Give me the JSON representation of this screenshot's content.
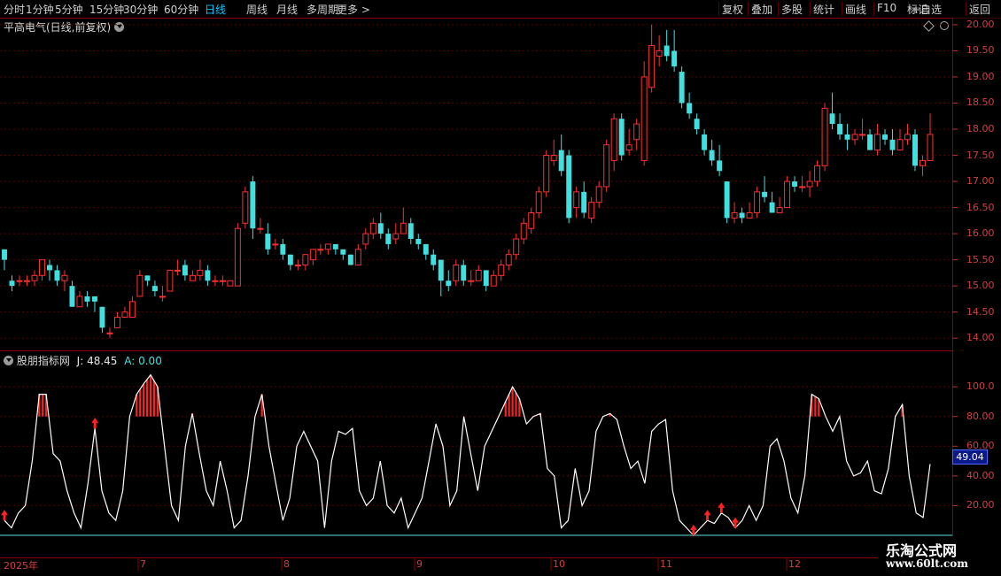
{
  "toolbar": {
    "left_items": [
      "分时",
      "1分钟",
      "5分钟",
      "15分钟",
      "30分钟",
      "60分钟",
      "日线",
      "周线",
      "月线",
      "多周期",
      "更多 >"
    ],
    "active": "日线",
    "right_items": [
      "复权",
      "叠加",
      "多股",
      "统计",
      "画线",
      "F10",
      "+自选",
      "返回"
    ],
    "marks_label": "标记"
  },
  "main_chart": {
    "title": "平高电气(日线,前复权)",
    "price_ticks": [
      "20.00",
      "19.50",
      "19.00",
      "18.50",
      "18.00",
      "17.50",
      "17.00",
      "16.50",
      "16.00",
      "15.50",
      "15.00",
      "14.50",
      "14.00"
    ]
  },
  "indicator": {
    "name": "股朋指标网",
    "j_label": "J: 48.45",
    "a_label": "A: 0.00",
    "ticks": [
      "100.0",
      "80.00",
      "60.00",
      "40.00",
      "20.00"
    ],
    "current_value": "49.04"
  },
  "x_axis": {
    "labels": [
      "2025年",
      "7",
      "8",
      "9",
      "10",
      "11",
      "12"
    ]
  },
  "watermark": {
    "line1": "乐淘公式网",
    "line2": "www.60lt.com"
  },
  "colors": {
    "up": "#ff3030",
    "down": "#40e0e0",
    "line": "#ffffff",
    "baseline": "#60e0e0",
    "grid": "#5a0000"
  },
  "chart_data": {
    "type": "candlestick",
    "ylim": [
      13.8,
      20.1
    ],
    "candles": [
      [
        15.7,
        15.5,
        15.7,
        15.3
      ],
      [
        15.1,
        15.0,
        15.2,
        14.9
      ],
      [
        15.1,
        15.1,
        15.2,
        15.0
      ],
      [
        15.1,
        15.1,
        15.2,
        15.0
      ],
      [
        15.1,
        15.2,
        15.3,
        15.0
      ],
      [
        15.2,
        15.5,
        15.5,
        15.1
      ],
      [
        15.4,
        15.3,
        15.5,
        15.1
      ],
      [
        15.3,
        15.1,
        15.4,
        15.0
      ],
      [
        15.1,
        15.2,
        15.3,
        14.9
      ],
      [
        15.0,
        14.6,
        15.1,
        14.6
      ],
      [
        14.6,
        14.8,
        14.9,
        14.6
      ],
      [
        14.8,
        14.7,
        14.9,
        14.6
      ],
      [
        14.8,
        14.7,
        14.8,
        14.5
      ],
      [
        14.6,
        14.2,
        14.6,
        14.1
      ],
      [
        14.1,
        14.1,
        14.2,
        14.0
      ],
      [
        14.2,
        14.4,
        14.5,
        14.2
      ],
      [
        14.4,
        14.5,
        14.6,
        14.4
      ],
      [
        14.4,
        14.7,
        14.8,
        14.4
      ],
      [
        14.8,
        15.2,
        15.3,
        14.8
      ],
      [
        15.2,
        15.1,
        15.2,
        15.0
      ],
      [
        15.0,
        14.9,
        15.1,
        14.8
      ],
      [
        14.8,
        14.8,
        15.0,
        14.7
      ],
      [
        14.9,
        15.3,
        15.3,
        14.9
      ],
      [
        15.3,
        15.3,
        15.5,
        15.2
      ],
      [
        15.4,
        15.2,
        15.5,
        15.1
      ],
      [
        15.1,
        15.2,
        15.3,
        15.1
      ],
      [
        15.2,
        15.3,
        15.5,
        15.1
      ],
      [
        15.3,
        15.1,
        15.4,
        15.0
      ],
      [
        15.1,
        15.1,
        15.2,
        15.0
      ],
      [
        15.1,
        15.1,
        15.2,
        15.0
      ],
      [
        15.0,
        15.1,
        15.1,
        15.0
      ],
      [
        15.0,
        16.1,
        16.2,
        15.9
      ],
      [
        16.2,
        16.8,
        16.9,
        16.1
      ],
      [
        17.0,
        16.1,
        17.1,
        15.9
      ],
      [
        16.1,
        16.1,
        16.3,
        16.0
      ],
      [
        16.0,
        15.7,
        16.2,
        15.6
      ],
      [
        15.8,
        15.8,
        15.9,
        15.7
      ],
      [
        15.8,
        15.6,
        15.9,
        15.5
      ],
      [
        15.6,
        15.4,
        15.6,
        15.3
      ],
      [
        15.4,
        15.4,
        15.5,
        15.3
      ],
      [
        15.4,
        15.6,
        15.6,
        15.3
      ],
      [
        15.5,
        15.7,
        15.7,
        15.4
      ],
      [
        15.7,
        15.7,
        15.8,
        15.6
      ],
      [
        15.7,
        15.8,
        15.8,
        15.6
      ],
      [
        15.8,
        15.7,
        15.8,
        15.6
      ],
      [
        15.7,
        15.6,
        15.7,
        15.5
      ],
      [
        15.6,
        15.4,
        15.6,
        15.4
      ],
      [
        15.4,
        15.7,
        15.8,
        15.4
      ],
      [
        15.8,
        16.0,
        16.1,
        15.7
      ],
      [
        16.0,
        16.2,
        16.3,
        15.9
      ],
      [
        16.2,
        16.0,
        16.4,
        15.9
      ],
      [
        16.0,
        15.8,
        16.1,
        15.7
      ],
      [
        15.9,
        16.0,
        16.2,
        15.8
      ],
      [
        16.0,
        16.2,
        16.5,
        16.0
      ],
      [
        16.2,
        15.9,
        16.3,
        15.8
      ],
      [
        15.9,
        15.8,
        16.0,
        15.7
      ],
      [
        15.8,
        15.6,
        15.8,
        15.5
      ],
      [
        15.6,
        15.4,
        15.7,
        15.3
      ],
      [
        15.5,
        15.1,
        15.5,
        14.8
      ],
      [
        15.1,
        15.0,
        15.3,
        14.9
      ],
      [
        15.1,
        15.4,
        15.5,
        15.0
      ],
      [
        15.4,
        15.1,
        15.5,
        15.0
      ],
      [
        15.1,
        15.1,
        15.3,
        15.0
      ],
      [
        15.1,
        15.3,
        15.4,
        15.1
      ],
      [
        15.3,
        15.0,
        15.3,
        14.9
      ],
      [
        15.0,
        15.2,
        15.3,
        15.0
      ],
      [
        15.2,
        15.4,
        15.5,
        15.1
      ],
      [
        15.4,
        15.6,
        15.7,
        15.3
      ],
      [
        15.6,
        15.9,
        16.0,
        15.5
      ],
      [
        15.9,
        16.2,
        16.3,
        15.8
      ],
      [
        16.1,
        16.4,
        16.5,
        16.0
      ],
      [
        16.4,
        16.8,
        16.9,
        16.3
      ],
      [
        16.8,
        17.5,
        17.6,
        16.7
      ],
      [
        17.4,
        17.5,
        17.8,
        17.3
      ],
      [
        17.6,
        17.2,
        17.9,
        17.1
      ],
      [
        17.5,
        16.3,
        17.6,
        16.2
      ],
      [
        16.5,
        16.8,
        16.9,
        16.3
      ],
      [
        16.8,
        16.4,
        17.0,
        16.3
      ],
      [
        16.3,
        16.6,
        16.7,
        16.2
      ],
      [
        16.6,
        16.9,
        17.0,
        16.5
      ],
      [
        16.9,
        17.7,
        17.8,
        16.8
      ],
      [
        17.4,
        18.2,
        18.3,
        17.2
      ],
      [
        18.2,
        17.5,
        18.3,
        17.4
      ],
      [
        17.6,
        17.7,
        18.0,
        17.5
      ],
      [
        17.8,
        18.1,
        18.2,
        17.6
      ],
      [
        17.4,
        19.0,
        19.3,
        17.3
      ],
      [
        18.8,
        19.6,
        20.0,
        18.7
      ],
      [
        19.4,
        19.5,
        19.8,
        19.2
      ],
      [
        19.6,
        19.4,
        19.9,
        19.3
      ],
      [
        19.5,
        19.2,
        19.9,
        19.1
      ],
      [
        19.1,
        18.5,
        19.2,
        18.4
      ],
      [
        18.5,
        18.3,
        18.7,
        18.2
      ],
      [
        18.2,
        18.0,
        18.3,
        17.9
      ],
      [
        17.9,
        17.6,
        18.0,
        17.5
      ],
      [
        17.6,
        17.4,
        17.8,
        17.3
      ],
      [
        17.4,
        17.2,
        17.7,
        17.1
      ],
      [
        17.0,
        16.3,
        17.0,
        16.2
      ],
      [
        16.3,
        16.4,
        16.6,
        16.2
      ],
      [
        16.4,
        16.3,
        16.5,
        16.2
      ],
      [
        16.3,
        16.4,
        16.6,
        16.3
      ],
      [
        16.4,
        16.8,
        16.9,
        16.3
      ],
      [
        16.8,
        16.7,
        17.1,
        16.6
      ],
      [
        16.6,
        16.4,
        16.8,
        16.4
      ],
      [
        16.4,
        16.5,
        16.7,
        16.4
      ],
      [
        16.5,
        17.0,
        17.1,
        16.5
      ],
      [
        17.0,
        16.9,
        17.1,
        16.8
      ],
      [
        16.9,
        16.9,
        17.1,
        16.8
      ],
      [
        16.9,
        17.0,
        17.2,
        16.7
      ],
      [
        17.0,
        17.3,
        17.4,
        16.9
      ],
      [
        17.3,
        18.4,
        18.5,
        17.2
      ],
      [
        18.3,
        18.1,
        18.7,
        18.0
      ],
      [
        18.1,
        17.9,
        18.3,
        17.8
      ],
      [
        17.9,
        17.8,
        18.1,
        17.6
      ],
      [
        17.8,
        17.9,
        18.0,
        17.7
      ],
      [
        17.9,
        17.9,
        18.2,
        17.8
      ],
      [
        17.9,
        17.6,
        18.0,
        17.6
      ],
      [
        17.6,
        17.9,
        18.1,
        17.5
      ],
      [
        17.9,
        17.8,
        18.0,
        17.7
      ],
      [
        17.8,
        17.6,
        18.0,
        17.5
      ],
      [
        17.6,
        17.8,
        18.0,
        17.6
      ],
      [
        17.8,
        17.9,
        18.1,
        17.7
      ],
      [
        17.9,
        17.3,
        18.0,
        17.2
      ],
      [
        17.3,
        17.4,
        17.5,
        17.1
      ],
      [
        17.4,
        17.9,
        18.3,
        17.4
      ]
    ],
    "indicator_ylim": [
      0,
      115
    ],
    "baseline": 0,
    "j_values": [
      10,
      5,
      15,
      20,
      50,
      95,
      95,
      55,
      50,
      30,
      15,
      5,
      35,
      72,
      30,
      15,
      10,
      30,
      80,
      95,
      102,
      108,
      100,
      60,
      20,
      10,
      60,
      82,
      55,
      30,
      20,
      50,
      30,
      5,
      10,
      40,
      80,
      95,
      60,
      35,
      10,
      25,
      60,
      70,
      60,
      50,
      5,
      50,
      70,
      68,
      72,
      30,
      20,
      25,
      50,
      20,
      15,
      25,
      5,
      15,
      25,
      50,
      75,
      60,
      20,
      30,
      80,
      55,
      30,
      60,
      70,
      80,
      90,
      100,
      92,
      75,
      80,
      82,
      45,
      40,
      5,
      10,
      45,
      20,
      30,
      70,
      80,
      82,
      78,
      60,
      45,
      50,
      35,
      70,
      75,
      78,
      30,
      10,
      5,
      0,
      5,
      10,
      8,
      15,
      12,
      5,
      10,
      20,
      10,
      20,
      60,
      65,
      50,
      25,
      15,
      40,
      95,
      92,
      80,
      70,
      80,
      50,
      40,
      42,
      50,
      30,
      28,
      45,
      80,
      88,
      40,
      15,
      12,
      48
    ]
  }
}
